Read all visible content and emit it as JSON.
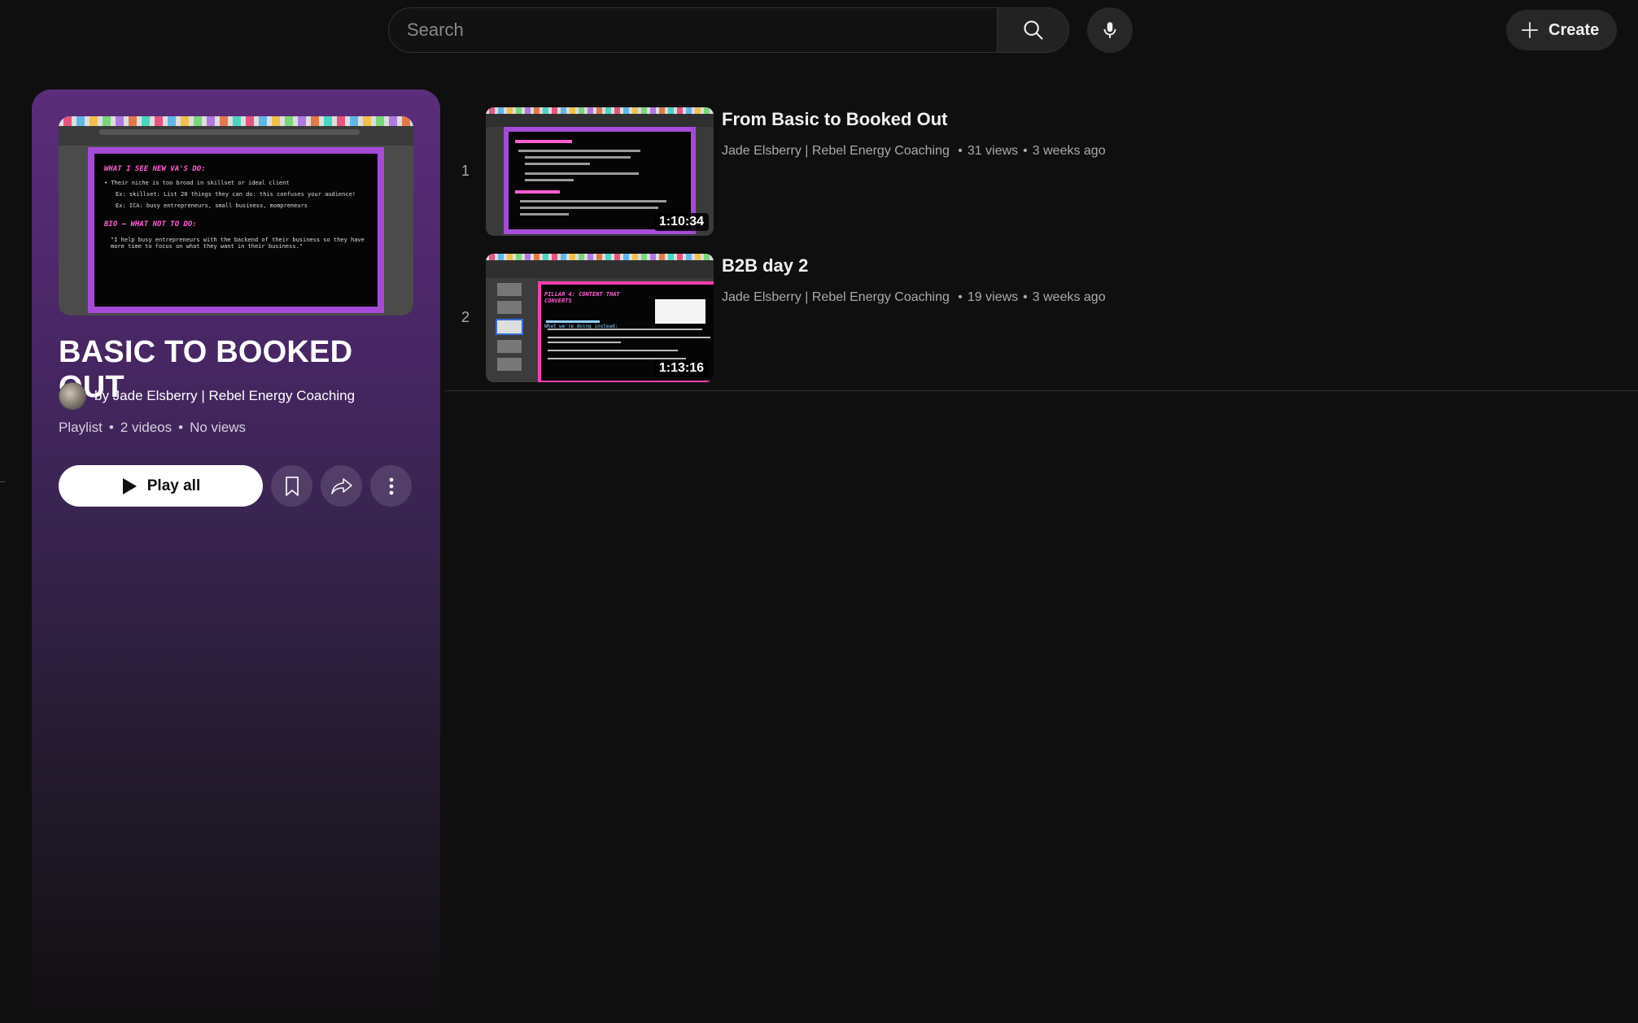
{
  "search": {
    "placeholder": "Search"
  },
  "header": {
    "create_label": "Create"
  },
  "playlist": {
    "title": "BASIC TO BOOKED OUT",
    "owner": "by Jade Elsberry | Rebel Energy Coaching",
    "type": "Playlist",
    "video_count": "2 videos",
    "views": "No views",
    "play_all_label": "Play all",
    "thumbnail": {
      "heading1": "WHAT I SEE NEW VA'S DO:",
      "bullet1": "• Their niche is too broad in skillset or ideal client",
      "sub1": "Ex: skillset: List 20 things they can do: this confuses your audience!",
      "sub2": "Ex: ICA: busy entrepreneurs, small business, mompreneurs",
      "heading2": "BIO – WHAT NOT TO DO:",
      "quote": "\"I help busy entrepreneurs with the backend of their business so they have more time to focus on what they want in their business.\""
    }
  },
  "videos": [
    {
      "index": "1",
      "title": "From Basic to Booked Out",
      "channel": "Jade Elsberry | Rebel Energy Coaching",
      "views": "31 views",
      "age": "3 weeks ago",
      "duration": "1:10:34"
    },
    {
      "index": "2",
      "title": "B2B day 2",
      "channel": "Jade Elsberry | Rebel Energy Coaching",
      "views": "19 views",
      "age": "3 weeks ago",
      "duration": "1:13:16",
      "slide_heading": "PILLAR 4: CONTENT THAT CONVERTS",
      "slide_sub": "What we're doing instead:"
    }
  ],
  "colors": {
    "background": "#0f0f0f",
    "panel_top": "#5b2d7a",
    "slide_border": "#a54bd8",
    "slide_text_pink": "#ff5fd2"
  }
}
